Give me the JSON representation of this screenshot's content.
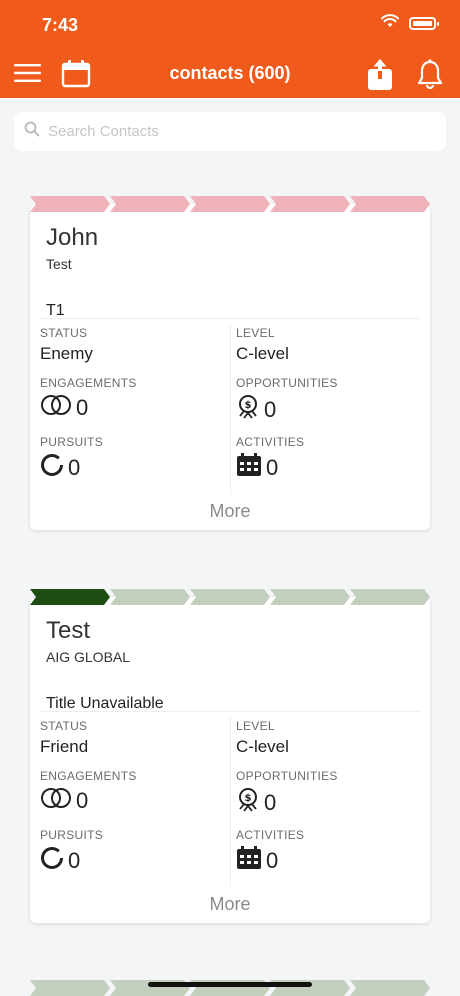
{
  "status_bar": {
    "time": "7:43"
  },
  "header": {
    "title": "contacts (600)"
  },
  "search": {
    "placeholder": "Search Contacts"
  },
  "colors": {
    "accent": "#f05a1a",
    "stage_pink": "#eeb2b8",
    "stage_green_active": "#1e4d12",
    "stage_green": "#c3cfbd"
  },
  "labels": {
    "status": "STATUS",
    "level": "LEVEL",
    "engagements": "ENGAGEMENTS",
    "opportunities": "OPPORTUNITIES",
    "pursuits": "PURSUITS",
    "activities": "ACTIVITIES",
    "more": "More"
  },
  "contacts": [
    {
      "name": "John",
      "company": "Test",
      "title": "T1",
      "status": "Enemy",
      "level": "C-level",
      "engagements": "0",
      "opportunities": "0",
      "pursuits": "0",
      "activities": "0"
    },
    {
      "name": "Test",
      "company": "AIG GLOBAL",
      "title": "Title Unavailable",
      "status": "Friend",
      "level": "C-level",
      "engagements": "0",
      "opportunities": "0",
      "pursuits": "0",
      "activities": "0"
    }
  ]
}
